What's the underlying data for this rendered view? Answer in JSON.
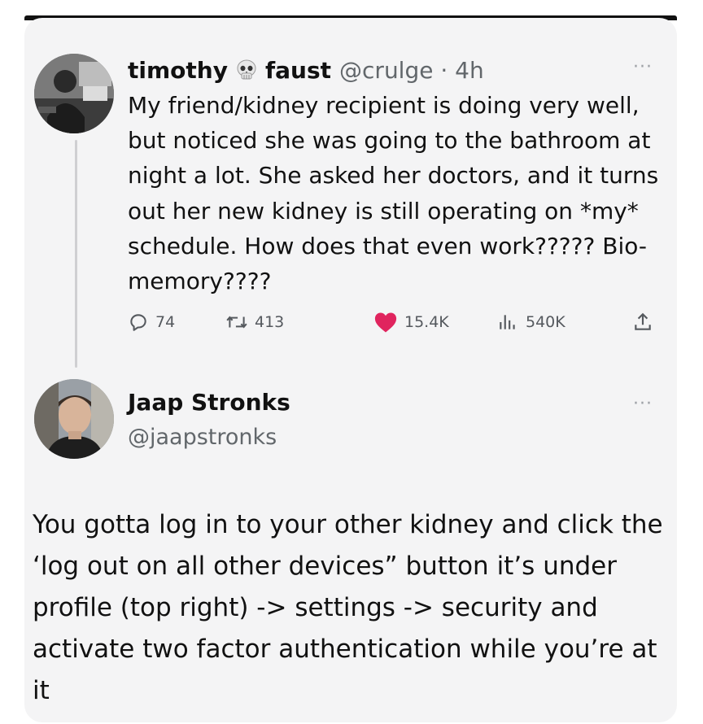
{
  "tweet": {
    "display_name_first": "timothy",
    "display_name_second": "faust",
    "handle_time": "@crulge · 4h",
    "more_label": "···",
    "text": "My friend/kidney recipient is doing very well, but noticed she was going to the bathroom at night a lot. She asked her doctors, and it turns out her new kidney is still operating on *my* schedule. How does that even work????? Bio-memory????",
    "stats": {
      "replies": "74",
      "retweets": "413",
      "likes": "15.4K",
      "views": "540K"
    }
  },
  "reply": {
    "display_name": "Jaap Stronks",
    "handle": "@jaapstronks",
    "more_label": "···",
    "text": "You gotta log in to your other kidney and click the ‘log out on all other devices” button it’s under profile (top right) -> settings -> security and activate two factor authentication while you’re at it"
  },
  "colors": {
    "like": "#e0245e",
    "muted": "#62676b",
    "card_bg": "#f4f4f5"
  },
  "icons": [
    "skull-icon",
    "reply-icon",
    "retweet-icon",
    "like-icon",
    "views-icon",
    "share-icon",
    "more-icon"
  ]
}
